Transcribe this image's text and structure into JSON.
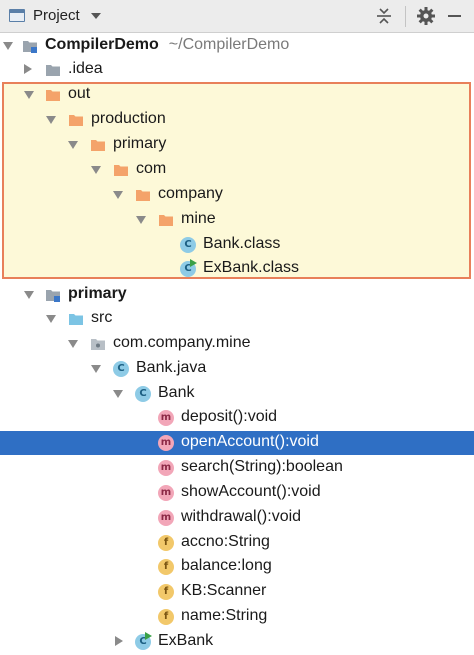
{
  "header": {
    "title": "Project",
    "icons": [
      "window-icon",
      "dropdown-caret-icon",
      "collapse-all-icon",
      "gear-icon",
      "minimize-icon"
    ]
  },
  "tree": [
    {
      "label": "CompilerDemo",
      "path": "~/CompilerDemo",
      "bold": true,
      "icon": "module-folder",
      "arrow": "down"
    },
    {
      "label": ".idea",
      "icon": "grey-folder",
      "arrow": "right"
    },
    {
      "label": "out",
      "icon": "orange-folder",
      "arrow": "down"
    },
    {
      "label": "production",
      "icon": "orange-folder",
      "arrow": "down"
    },
    {
      "label": "primary",
      "icon": "orange-folder",
      "arrow": "down"
    },
    {
      "label": "com",
      "icon": "orange-folder",
      "arrow": "down"
    },
    {
      "label": "company",
      "icon": "orange-folder",
      "arrow": "down"
    },
    {
      "label": "mine",
      "icon": "orange-folder",
      "arrow": "down"
    },
    {
      "label": "Bank.class",
      "icon": "class"
    },
    {
      "label": "ExBank.class",
      "icon": "class-runnable"
    },
    {
      "label": "primary",
      "bold": true,
      "icon": "module-folder",
      "arrow": "down"
    },
    {
      "label": "src",
      "icon": "source-folder",
      "arrow": "down"
    },
    {
      "label": "com.company.mine",
      "icon": "package",
      "arrow": "down"
    },
    {
      "label": "Bank.java",
      "icon": "class",
      "arrow": "down"
    },
    {
      "label": "Bank",
      "icon": "class",
      "arrow": "down"
    },
    {
      "label": "deposit():void",
      "icon": "method"
    },
    {
      "label": "openAccount():void",
      "icon": "method",
      "selected": true
    },
    {
      "label": "search(String):boolean",
      "icon": "method"
    },
    {
      "label": "showAccount():void",
      "icon": "method"
    },
    {
      "label": "withdrawal():void",
      "icon": "method"
    },
    {
      "label": "accno:String",
      "icon": "field"
    },
    {
      "label": "balance:long",
      "icon": "field"
    },
    {
      "label": "KB:Scanner",
      "icon": "field"
    },
    {
      "label": "name:String",
      "icon": "field"
    },
    {
      "label": "ExBank",
      "icon": "class-runnable",
      "arrow": "right"
    }
  ],
  "colors": {
    "selection": "#2f6fc4",
    "highlight_fill": "#fdf9d8",
    "highlight_border": "#e8805a",
    "orange_folder": "#f4a36a",
    "grey_folder": "#9aa4ae",
    "source_folder": "#7cc4e4"
  }
}
